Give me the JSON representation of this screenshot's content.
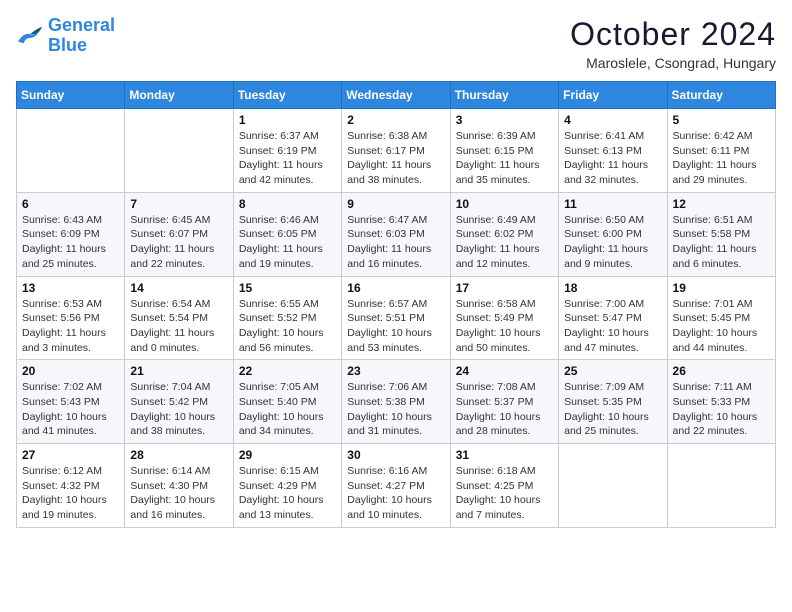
{
  "header": {
    "logo_line1": "General",
    "logo_line2": "Blue",
    "month_title": "October 2024",
    "location": "Maroslele, Csongrad, Hungary"
  },
  "days_of_week": [
    "Sunday",
    "Monday",
    "Tuesday",
    "Wednesday",
    "Thursday",
    "Friday",
    "Saturday"
  ],
  "weeks": [
    [
      {
        "day": "",
        "sunrise": "",
        "sunset": "",
        "daylight": ""
      },
      {
        "day": "",
        "sunrise": "",
        "sunset": "",
        "daylight": ""
      },
      {
        "day": "1",
        "sunrise": "Sunrise: 6:37 AM",
        "sunset": "Sunset: 6:19 PM",
        "daylight": "Daylight: 11 hours and 42 minutes."
      },
      {
        "day": "2",
        "sunrise": "Sunrise: 6:38 AM",
        "sunset": "Sunset: 6:17 PM",
        "daylight": "Daylight: 11 hours and 38 minutes."
      },
      {
        "day": "3",
        "sunrise": "Sunrise: 6:39 AM",
        "sunset": "Sunset: 6:15 PM",
        "daylight": "Daylight: 11 hours and 35 minutes."
      },
      {
        "day": "4",
        "sunrise": "Sunrise: 6:41 AM",
        "sunset": "Sunset: 6:13 PM",
        "daylight": "Daylight: 11 hours and 32 minutes."
      },
      {
        "day": "5",
        "sunrise": "Sunrise: 6:42 AM",
        "sunset": "Sunset: 6:11 PM",
        "daylight": "Daylight: 11 hours and 29 minutes."
      }
    ],
    [
      {
        "day": "6",
        "sunrise": "Sunrise: 6:43 AM",
        "sunset": "Sunset: 6:09 PM",
        "daylight": "Daylight: 11 hours and 25 minutes."
      },
      {
        "day": "7",
        "sunrise": "Sunrise: 6:45 AM",
        "sunset": "Sunset: 6:07 PM",
        "daylight": "Daylight: 11 hours and 22 minutes."
      },
      {
        "day": "8",
        "sunrise": "Sunrise: 6:46 AM",
        "sunset": "Sunset: 6:05 PM",
        "daylight": "Daylight: 11 hours and 19 minutes."
      },
      {
        "day": "9",
        "sunrise": "Sunrise: 6:47 AM",
        "sunset": "Sunset: 6:03 PM",
        "daylight": "Daylight: 11 hours and 16 minutes."
      },
      {
        "day": "10",
        "sunrise": "Sunrise: 6:49 AM",
        "sunset": "Sunset: 6:02 PM",
        "daylight": "Daylight: 11 hours and 12 minutes."
      },
      {
        "day": "11",
        "sunrise": "Sunrise: 6:50 AM",
        "sunset": "Sunset: 6:00 PM",
        "daylight": "Daylight: 11 hours and 9 minutes."
      },
      {
        "day": "12",
        "sunrise": "Sunrise: 6:51 AM",
        "sunset": "Sunset: 5:58 PM",
        "daylight": "Daylight: 11 hours and 6 minutes."
      }
    ],
    [
      {
        "day": "13",
        "sunrise": "Sunrise: 6:53 AM",
        "sunset": "Sunset: 5:56 PM",
        "daylight": "Daylight: 11 hours and 3 minutes."
      },
      {
        "day": "14",
        "sunrise": "Sunrise: 6:54 AM",
        "sunset": "Sunset: 5:54 PM",
        "daylight": "Daylight: 11 hours and 0 minutes."
      },
      {
        "day": "15",
        "sunrise": "Sunrise: 6:55 AM",
        "sunset": "Sunset: 5:52 PM",
        "daylight": "Daylight: 10 hours and 56 minutes."
      },
      {
        "day": "16",
        "sunrise": "Sunrise: 6:57 AM",
        "sunset": "Sunset: 5:51 PM",
        "daylight": "Daylight: 10 hours and 53 minutes."
      },
      {
        "day": "17",
        "sunrise": "Sunrise: 6:58 AM",
        "sunset": "Sunset: 5:49 PM",
        "daylight": "Daylight: 10 hours and 50 minutes."
      },
      {
        "day": "18",
        "sunrise": "Sunrise: 7:00 AM",
        "sunset": "Sunset: 5:47 PM",
        "daylight": "Daylight: 10 hours and 47 minutes."
      },
      {
        "day": "19",
        "sunrise": "Sunrise: 7:01 AM",
        "sunset": "Sunset: 5:45 PM",
        "daylight": "Daylight: 10 hours and 44 minutes."
      }
    ],
    [
      {
        "day": "20",
        "sunrise": "Sunrise: 7:02 AM",
        "sunset": "Sunset: 5:43 PM",
        "daylight": "Daylight: 10 hours and 41 minutes."
      },
      {
        "day": "21",
        "sunrise": "Sunrise: 7:04 AM",
        "sunset": "Sunset: 5:42 PM",
        "daylight": "Daylight: 10 hours and 38 minutes."
      },
      {
        "day": "22",
        "sunrise": "Sunrise: 7:05 AM",
        "sunset": "Sunset: 5:40 PM",
        "daylight": "Daylight: 10 hours and 34 minutes."
      },
      {
        "day": "23",
        "sunrise": "Sunrise: 7:06 AM",
        "sunset": "Sunset: 5:38 PM",
        "daylight": "Daylight: 10 hours and 31 minutes."
      },
      {
        "day": "24",
        "sunrise": "Sunrise: 7:08 AM",
        "sunset": "Sunset: 5:37 PM",
        "daylight": "Daylight: 10 hours and 28 minutes."
      },
      {
        "day": "25",
        "sunrise": "Sunrise: 7:09 AM",
        "sunset": "Sunset: 5:35 PM",
        "daylight": "Daylight: 10 hours and 25 minutes."
      },
      {
        "day": "26",
        "sunrise": "Sunrise: 7:11 AM",
        "sunset": "Sunset: 5:33 PM",
        "daylight": "Daylight: 10 hours and 22 minutes."
      }
    ],
    [
      {
        "day": "27",
        "sunrise": "Sunrise: 6:12 AM",
        "sunset": "Sunset: 4:32 PM",
        "daylight": "Daylight: 10 hours and 19 minutes."
      },
      {
        "day": "28",
        "sunrise": "Sunrise: 6:14 AM",
        "sunset": "Sunset: 4:30 PM",
        "daylight": "Daylight: 10 hours and 16 minutes."
      },
      {
        "day": "29",
        "sunrise": "Sunrise: 6:15 AM",
        "sunset": "Sunset: 4:29 PM",
        "daylight": "Daylight: 10 hours and 13 minutes."
      },
      {
        "day": "30",
        "sunrise": "Sunrise: 6:16 AM",
        "sunset": "Sunset: 4:27 PM",
        "daylight": "Daylight: 10 hours and 10 minutes."
      },
      {
        "day": "31",
        "sunrise": "Sunrise: 6:18 AM",
        "sunset": "Sunset: 4:25 PM",
        "daylight": "Daylight: 10 hours and 7 minutes."
      },
      {
        "day": "",
        "sunrise": "",
        "sunset": "",
        "daylight": ""
      },
      {
        "day": "",
        "sunrise": "",
        "sunset": "",
        "daylight": ""
      }
    ]
  ]
}
